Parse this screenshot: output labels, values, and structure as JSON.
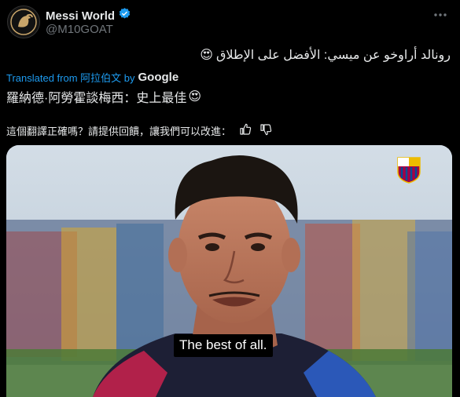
{
  "account": {
    "name": "Messi World",
    "handle": "@M10GOAT",
    "verified": true
  },
  "post": {
    "original_text": "رونالد أراوخو عن ميسي: الأفضل على الإطلاق",
    "translated_by_label": "Translated from 阿拉伯文 by",
    "translator": "Google",
    "translation_text": "羅納德·阿勞霍談梅西：史上最佳",
    "feedback_prompt": "這個翻譯正確嗎？請提供回饋，讓我們可以改進：",
    "emoji": "😍"
  },
  "media": {
    "caption": "The best of all."
  },
  "colors": {
    "background": "#000000",
    "text_primary": "#e7e9ea",
    "text_secondary": "#71767b",
    "link": "#1d9bf0",
    "verified_badge": "#1d9bf0"
  },
  "icons": [
    "more-icon",
    "verified-badge-icon",
    "thumbs-up-icon",
    "thumbs-down-icon",
    "google-logo-icon"
  ]
}
